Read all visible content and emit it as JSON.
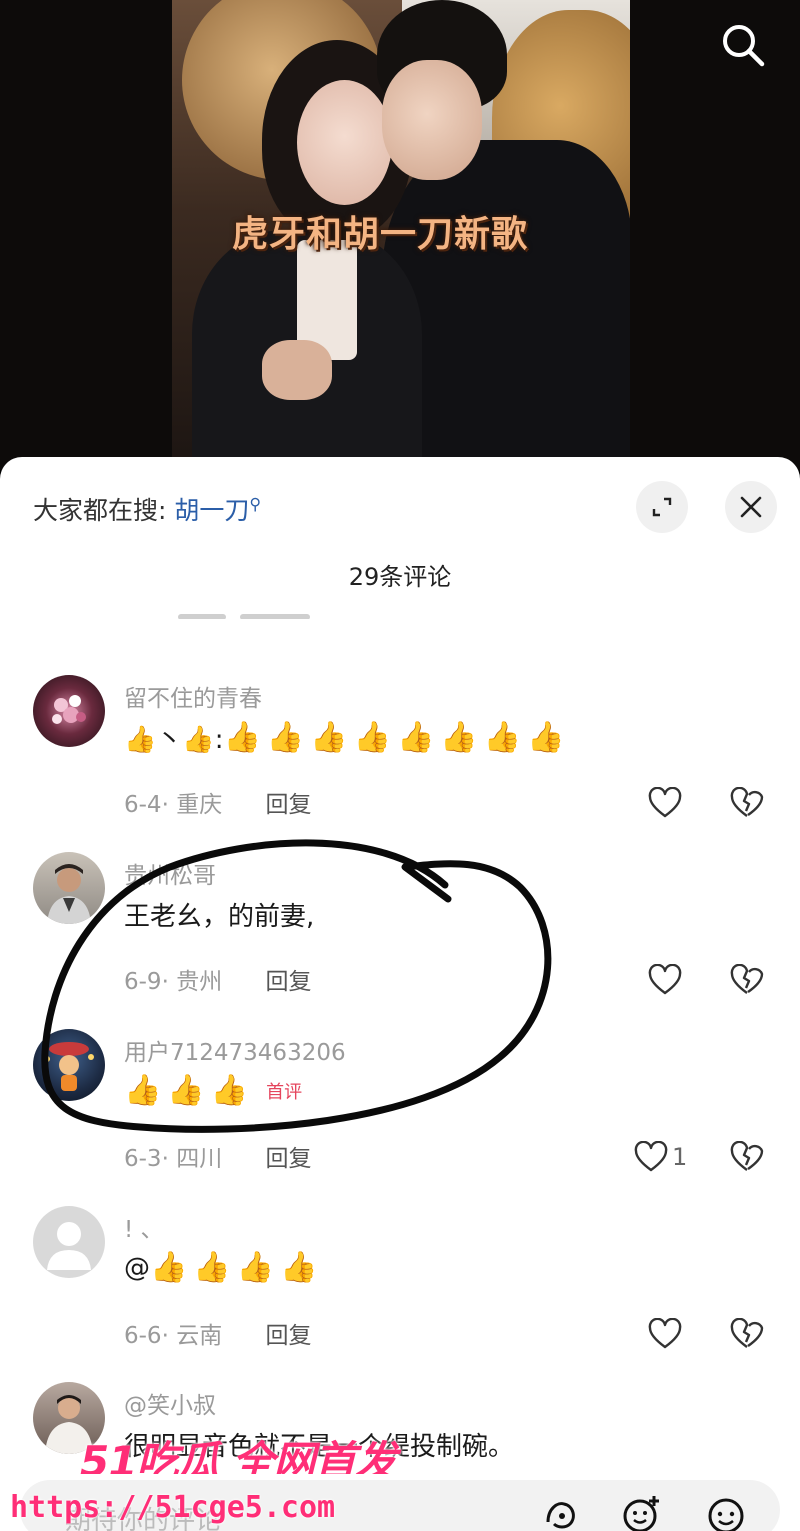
{
  "video": {
    "caption": "虎牙和胡一刀新歌"
  },
  "sheet": {
    "search_prefix": "大家都在搜:",
    "search_keyword": "胡一刀",
    "comment_count": "29条评论"
  },
  "comments": [
    {
      "username": "留不住的青春",
      "text_prefix": "👍丶👍:",
      "thumbs_after": 8,
      "date_location": "6-4· 重庆",
      "reply": "回复",
      "likes": ""
    },
    {
      "username": "贵州松哥",
      "text": "王老幺，的前妻,",
      "date_location": "6-9· 贵州",
      "reply": "回复",
      "likes": ""
    },
    {
      "username": "用户712473463206",
      "thumbs": 3,
      "badge": "首评",
      "date_location": "6-3· 四川",
      "reply": "回复",
      "likes": "1"
    },
    {
      "username": "! 、",
      "text_prefix": "@",
      "thumbs": 4,
      "date_location": "6-6· 云南",
      "reply": "回复",
      "likes": ""
    },
    {
      "username": "@笑小叔",
      "text": "很明显音色就不是一个缇投制碗。"
    }
  ],
  "bottom_bar": {
    "placeholder": "期待你的评论",
    "icons": [
      "gift-icon",
      "emoji-add-icon",
      "emoji-icon"
    ]
  },
  "watermark": {
    "brand": "51吃瓜 全网首发",
    "url": "https://51cge5.com"
  },
  "colors": {
    "keyword": "#2b5ea8",
    "first_badge": "#e5455d",
    "watermark": "#ff2e77",
    "caption": "#f4b483"
  }
}
